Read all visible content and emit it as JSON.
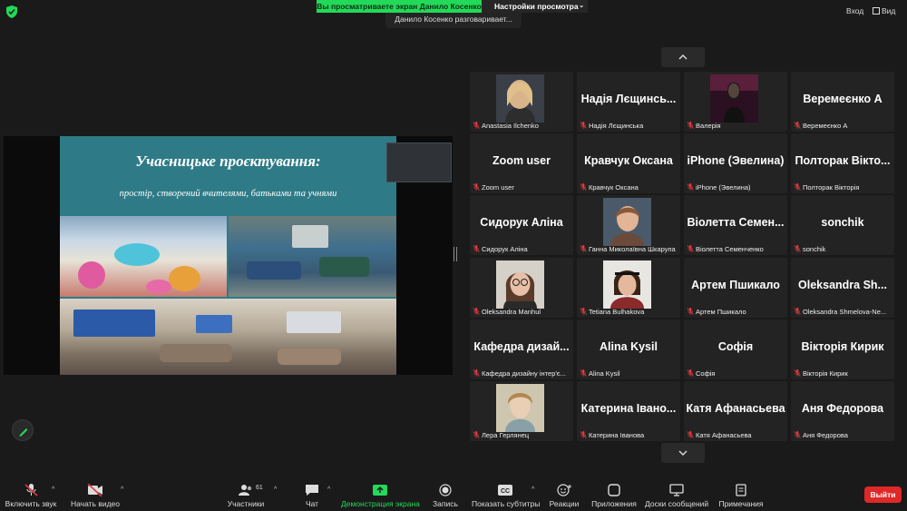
{
  "top": {
    "share_banner": "Вы просматриваете экран Данило Косенко",
    "view_options": "Настройки просмотра",
    "speaking": "Данило Косенко разговаривает...",
    "enter": "Вход",
    "view": "Вид"
  },
  "slide": {
    "title": "Учасницьке проєктування:",
    "subtitle": "простір, створений вчителями, батьками та учнями"
  },
  "participants": [
    {
      "big": "",
      "label": "Anastasia Ilchenko",
      "photo": "photo-blonde"
    },
    {
      "big": "Надія Лєщинсь...",
      "label": "Надія Лєщинська"
    },
    {
      "big": "",
      "label": "Валерія",
      "photo": "photo-dark"
    },
    {
      "big": "Веремеєнко А",
      "label": "Веремеєнко А"
    },
    {
      "big": "Zoom user",
      "label": "Zoom user"
    },
    {
      "big": "Кравчук Оксана",
      "label": "Кравчук Оксана"
    },
    {
      "big": "iPhone (Эвелина)",
      "label": "iPhone (Эвелина)"
    },
    {
      "big": "Полторак Вікто...",
      "label": "Полторак Вікторія"
    },
    {
      "big": "Сидорук Аліна",
      "label": "Сидорук Аліна"
    },
    {
      "big": "",
      "label": "Ганна Миколаївна Шкарупа",
      "photo": "photo-woman"
    },
    {
      "big": "Віолетта Семен...",
      "label": "Віолетта Семенченко"
    },
    {
      "big": "sonchik",
      "label": "sonchik"
    },
    {
      "big": "",
      "label": "Oleksandra Manhul",
      "photo": "photo-glasses"
    },
    {
      "big": "",
      "label": "Tetiana Bulhakova",
      "photo": "photo-headband"
    },
    {
      "big": "Артем Пшикало",
      "label": "Артем Пшикало"
    },
    {
      "big": "Oleksandra Sh...",
      "label": "Oleksandra Shmelova-Ne..."
    },
    {
      "big": "Кафедра дизай...",
      "label": "Кафедра дизайну інтер'є..."
    },
    {
      "big": "Alina Kysil",
      "label": "Alina Kysil"
    },
    {
      "big": "Софія",
      "label": "Софія"
    },
    {
      "big": "Вікторія Кирик",
      "label": "Вікторія Кирик"
    },
    {
      "big": "",
      "label": "Лера Герлянец",
      "photo": "photo-painting"
    },
    {
      "big": "Катерина Івано...",
      "label": "Катерина Іванова"
    },
    {
      "big": "Катя Афанасьева",
      "label": "Катя Афанасьева"
    },
    {
      "big": "Аня Федорова",
      "label": "Аня Федорова"
    }
  ],
  "toolbar": {
    "mute": "Включить звук",
    "video": "Начать видео",
    "participants": "Участники",
    "participants_count": "61",
    "chat": "Чат",
    "share": "Демонстрация экрана",
    "record": "Запись",
    "captions": "Показать субтитры",
    "reactions": "Реакции",
    "apps": "Приложения",
    "whiteboards": "Доски сообщений",
    "notes": "Примечания",
    "leave": "Выйти"
  },
  "colors": {
    "share_green": "#23d959",
    "leave_red": "#e02828",
    "muted_red": "#e0393e"
  }
}
